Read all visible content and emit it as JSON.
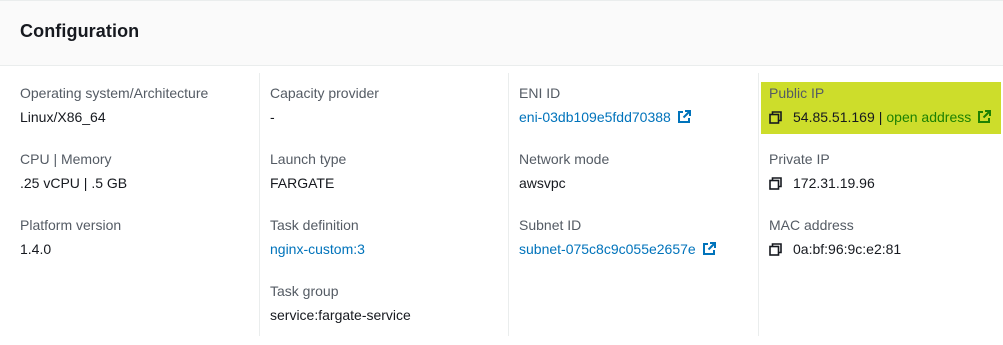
{
  "panel": {
    "title": "Configuration"
  },
  "columns": [
    {
      "fields": [
        {
          "label": "Operating system/Architecture",
          "value": "Linux/X86_64"
        },
        {
          "label": "CPU | Memory",
          "value": ".25 vCPU | .5 GB"
        },
        {
          "label": "Platform version",
          "value": "1.4.0"
        }
      ]
    },
    {
      "fields": [
        {
          "label": "Capacity provider",
          "value": "-"
        },
        {
          "label": "Launch type",
          "value": "FARGATE"
        },
        {
          "label": "Task definition",
          "value": "nginx-custom:3"
        },
        {
          "label": "Task group",
          "value": "service:fargate-service"
        }
      ]
    },
    {
      "fields": [
        {
          "label": "ENI ID",
          "value": "eni-03db109e5fdd70388"
        },
        {
          "label": "Network mode",
          "value": "awsvpc"
        },
        {
          "label": "Subnet ID",
          "value": "subnet-075c8c9c055e2657e"
        }
      ]
    },
    {
      "fields": [
        {
          "label": "Public IP",
          "value": "54.85.51.169",
          "separator": "|",
          "link": "open address"
        },
        {
          "label": "Private IP",
          "value": "172.31.19.96"
        },
        {
          "label": "MAC address",
          "value": "0a:bf:96:9c:e2:81"
        }
      ]
    }
  ],
  "colors": {
    "link": "#0073bb",
    "open_address_link": "#1d8102",
    "highlight": "#cddd2b"
  },
  "icons": {
    "external_link": "external-link-icon",
    "copy": "copy-icon"
  }
}
